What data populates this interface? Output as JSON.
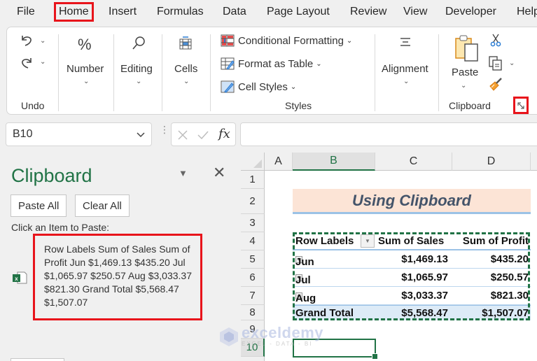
{
  "menu": {
    "tabs": [
      "File",
      "Home",
      "Insert",
      "Formulas",
      "Data",
      "Page Layout",
      "Review",
      "View",
      "Developer",
      "Help"
    ],
    "active": "Home"
  },
  "ribbon": {
    "undo": {
      "group_label": "Undo"
    },
    "number": {
      "label": "Number"
    },
    "editing": {
      "label": "Editing"
    },
    "cells": {
      "label": "Cells"
    },
    "styles": {
      "group_label": "Styles",
      "conditional_formatting": "Conditional Formatting",
      "format_as_table": "Format as Table",
      "cell_styles": "Cell Styles"
    },
    "alignment": {
      "label": "Alignment"
    },
    "clipboard": {
      "group_label": "Clipboard",
      "paste": "Paste"
    }
  },
  "formula_bar": {
    "name_box": "B10",
    "fx": "fx",
    "formula": ""
  },
  "clipboard_pane": {
    "title": "Clipboard",
    "paste_all": "Paste All",
    "clear_all": "Clear All",
    "hint": "Click an Item to Paste:",
    "items": [
      {
        "type": "excel",
        "text": "Row Labels Sum of Sales Sum of Profit Jun $1,469.13 $435.20 Jul $1,065.97 $250.57 Aug $3,033.37 $821.30 Grand Total $5,568.47 $1,507.07"
      }
    ]
  },
  "sheet": {
    "columns": [
      "A",
      "B",
      "C",
      "D"
    ],
    "selected_column": "B",
    "rows": [
      "1",
      "2",
      "3",
      "4",
      "5",
      "6",
      "7",
      "8",
      "9",
      "10"
    ],
    "selected_row": "10",
    "title": "Using Clipboard",
    "pivot": {
      "headers": [
        "Row Labels",
        "Sum of Sales",
        "Sum of Profit"
      ],
      "rows": [
        {
          "label": "Jun",
          "sales": "$1,469.13",
          "profit": "$435.20"
        },
        {
          "label": "Jul",
          "sales": "$1,065.97",
          "profit": "$250.57"
        },
        {
          "label": "Aug",
          "sales": "$3,033.37",
          "profit": "$821.30"
        }
      ],
      "total": {
        "label": "Grand Total",
        "sales": "$5,568.47",
        "profit": "$1,507.07"
      }
    }
  },
  "watermark": {
    "name": "exceldemy",
    "tagline": "EXCEL - DATA - BI"
  },
  "colors": {
    "accent": "#217346",
    "highlight": "#e8141b",
    "title_fill": "#fce4d6",
    "total_fill": "#ddebf7"
  }
}
